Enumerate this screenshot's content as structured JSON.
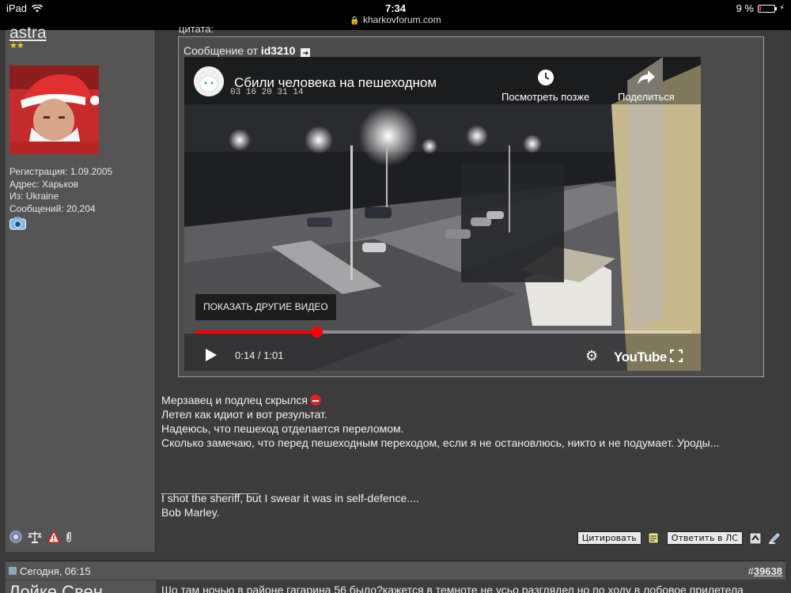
{
  "status_bar": {
    "device": "iPad",
    "time": "7:34",
    "battery": "9 %",
    "battery_level": 0.09
  },
  "url_bar": {
    "domain": "kharkovforum.com"
  },
  "post": {
    "user": {
      "name": "astra",
      "stars": "★★",
      "info": [
        "Регистрация: 1.09.2005",
        "Адрес: Харьков",
        "Из: Ukraine",
        "Сообщений: 20,204"
      ]
    },
    "quote": {
      "cut_text": "цитата:",
      "prefix": "Сообщение от",
      "author": "id3210"
    },
    "video": {
      "title": "Сбили человека на пешеходном",
      "watch_later": "Посмотреть позже",
      "share": "Поделиться",
      "more_videos": "ПОКАЗАТЬ ДРУГИЕ ВИДЕО",
      "time": "0:14 / 1:01",
      "progress": 0.245,
      "logo": "YouTube",
      "timestamp_overlay": "03 16 20 31 14"
    },
    "message_lines": [
      "Мерзавец и подлец скрылся",
      "Летел как идиот и вот результат.",
      "Надеюсь, что пешеход отделается переломом.",
      "Сколько замечаю, что перед пешеходным переходом, если я не остановлюсь, никто и не подумает. Уроды..."
    ],
    "signature_rule": "__________________",
    "signature_lines": [
      "I shot the sheriff, but I swear it was in self-defence....",
      "Bob Marley."
    ],
    "actions": {
      "quote": "Цитировать",
      "reply_pm": "Ответить в ЛС"
    }
  },
  "next_post": {
    "date": "Сегодня, 06:15",
    "hash": "#",
    "number": "39638",
    "user_partial": "Лойке Свен",
    "text_partial": "Шо там ночью в районе гагарина 56 было?кажется в темноте не усьо разглядел но по ходу в лобовое прилетела"
  }
}
